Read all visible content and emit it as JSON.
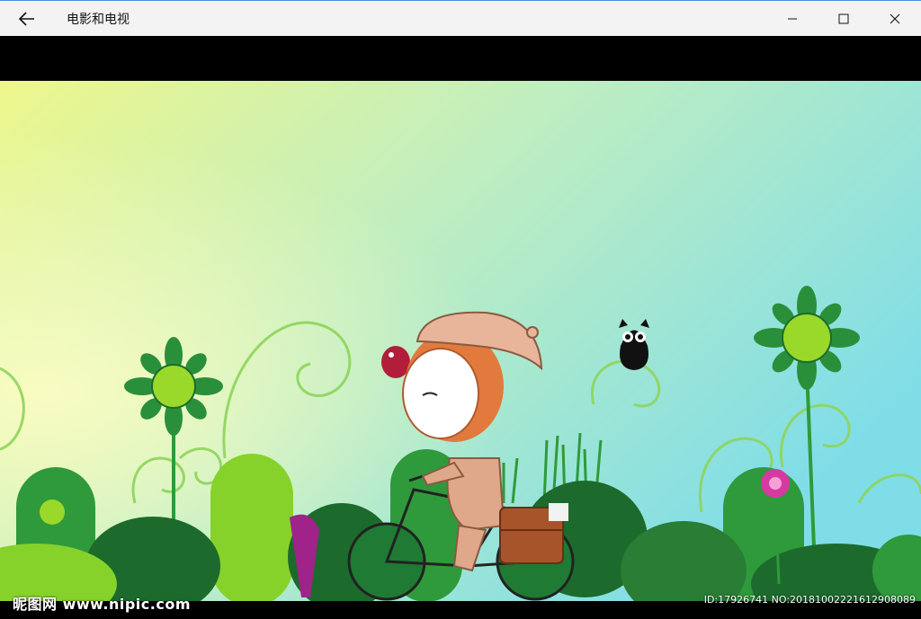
{
  "window": {
    "title": "电影和电视",
    "back_icon": "back-arrow-icon",
    "minimize_icon": "minimize-icon",
    "maximize_icon": "maximize-icon",
    "close_icon": "close-icon"
  },
  "video": {
    "watermark_left": "昵图网 www.nipic.com",
    "watermark_right": "ID:17926741 NO:20181002221612908089",
    "colors": {
      "sky_top": "#e8f58a",
      "sky_mid": "#b8ecc6",
      "sky_right": "#86e0e8",
      "grass_dark": "#1c6b2c",
      "grass_mid": "#2f9a3b",
      "grass_light": "#86d22a",
      "flower_center": "#9ad82a",
      "hat": "#e8b49a",
      "hair": "#e27a3e",
      "bag": "#a8542a"
    }
  }
}
